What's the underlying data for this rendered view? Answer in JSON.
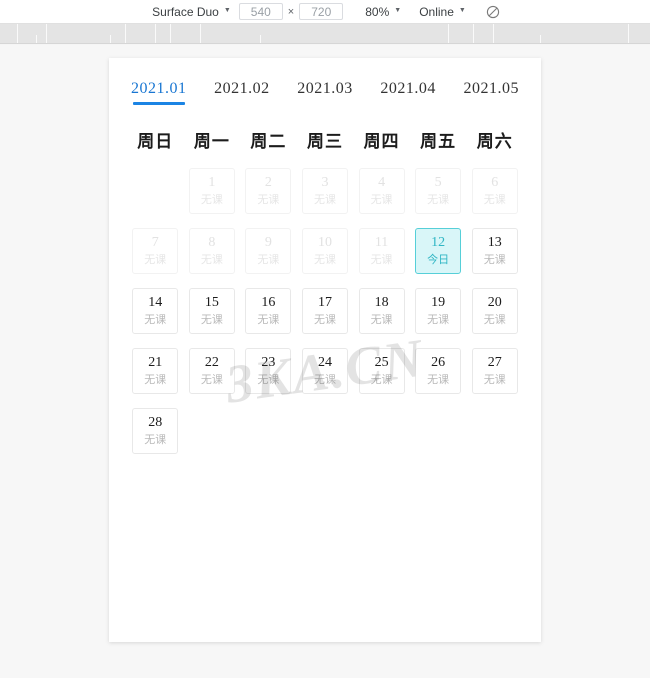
{
  "device_toolbar": {
    "device_name": "Surface Duo",
    "width_value": "540",
    "height_value": "720",
    "dimension_separator": "×",
    "zoom_value": "80%",
    "network_value": "Online",
    "caret": "▼",
    "throttle_icon": "no-throttling-icon"
  },
  "calendar": {
    "month_tabs": [
      {
        "label": "2021.01",
        "active": true
      },
      {
        "label": "2021.02",
        "active": false
      },
      {
        "label": "2021.03",
        "active": false
      },
      {
        "label": "2021.04",
        "active": false
      },
      {
        "label": "2021.05",
        "active": false
      }
    ],
    "weekdays": [
      "周日",
      "周一",
      "周二",
      "周三",
      "周四",
      "周五",
      "周六"
    ],
    "no_class_label": "无课",
    "today_label": "今日",
    "leading_blanks": 1,
    "days": [
      {
        "num": "1",
        "label": "无课",
        "state": "muted"
      },
      {
        "num": "2",
        "label": "无课",
        "state": "muted"
      },
      {
        "num": "3",
        "label": "无课",
        "state": "muted"
      },
      {
        "num": "4",
        "label": "无课",
        "state": "muted"
      },
      {
        "num": "5",
        "label": "无课",
        "state": "muted"
      },
      {
        "num": "6",
        "label": "无课",
        "state": "muted"
      },
      {
        "num": "7",
        "label": "无课",
        "state": "muted"
      },
      {
        "num": "8",
        "label": "无课",
        "state": "muted"
      },
      {
        "num": "9",
        "label": "无课",
        "state": "muted"
      },
      {
        "num": "10",
        "label": "无课",
        "state": "muted"
      },
      {
        "num": "11",
        "label": "无课",
        "state": "muted"
      },
      {
        "num": "12",
        "label": "今日",
        "state": "today"
      },
      {
        "num": "13",
        "label": "无课",
        "state": "normal"
      },
      {
        "num": "14",
        "label": "无课",
        "state": "normal"
      },
      {
        "num": "15",
        "label": "无课",
        "state": "normal"
      },
      {
        "num": "16",
        "label": "无课",
        "state": "normal"
      },
      {
        "num": "17",
        "label": "无课",
        "state": "normal"
      },
      {
        "num": "18",
        "label": "无课",
        "state": "normal"
      },
      {
        "num": "19",
        "label": "无课",
        "state": "normal"
      },
      {
        "num": "20",
        "label": "无课",
        "state": "normal"
      },
      {
        "num": "21",
        "label": "无课",
        "state": "normal"
      },
      {
        "num": "22",
        "label": "无课",
        "state": "normal"
      },
      {
        "num": "23",
        "label": "无课",
        "state": "normal"
      },
      {
        "num": "24",
        "label": "无课",
        "state": "normal"
      },
      {
        "num": "25",
        "label": "无课",
        "state": "normal"
      },
      {
        "num": "26",
        "label": "无课",
        "state": "normal"
      },
      {
        "num": "27",
        "label": "无课",
        "state": "normal"
      },
      {
        "num": "28",
        "label": "无课",
        "state": "normal"
      }
    ]
  },
  "watermark": {
    "text": "3KA.CN"
  },
  "colors": {
    "accent_blue": "#1b84e4",
    "today_bg": "#d9f6f8",
    "today_border": "#56cfd8",
    "today_text": "#2fb6c4",
    "muted_text": "#e2e2e2"
  }
}
